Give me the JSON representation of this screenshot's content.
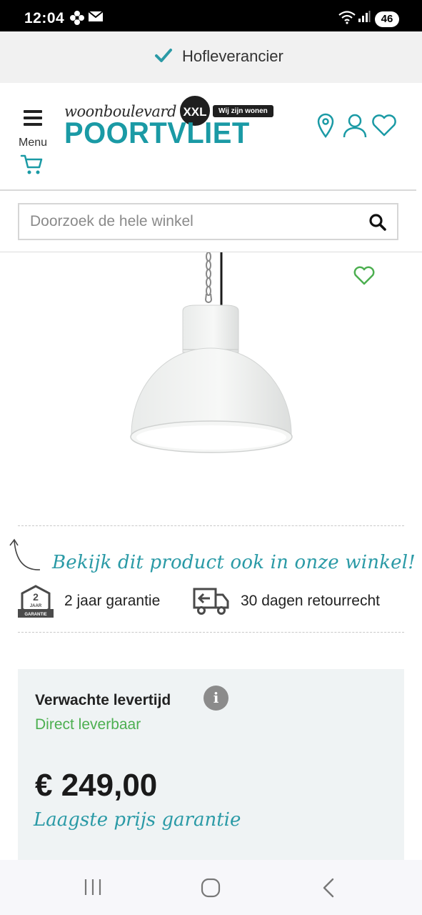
{
  "status_bar": {
    "time": "12:04",
    "battery": "46"
  },
  "top_banner": {
    "text": "Hofleverancier"
  },
  "header": {
    "menu_label": "Menu",
    "logo": {
      "small_text": "woonboulevard",
      "badge": "XXL",
      "tagline": "Wij zijn wonen",
      "big_text": "POORTVLIET"
    }
  },
  "search": {
    "placeholder": "Doorzoek de hele winkel"
  },
  "product": {
    "store_cta": "Bekijk dit product ook in onze winkel!",
    "usps": [
      {
        "icon": "guarantee-badge-icon",
        "badge_number": "2",
        "badge_word": "JAAR",
        "badge_sub": "GARANTIE",
        "text": "2 jaar garantie"
      },
      {
        "icon": "return-truck-icon",
        "text": "30 dagen retourrecht"
      }
    ]
  },
  "delivery": {
    "label": "Verwachte levertijd",
    "info_symbol": "i",
    "status": "Direct leverbaar",
    "price": "€ 249,00",
    "price_guarantee": "Laagste prijs garantie"
  },
  "colors": {
    "brand_teal": "#1a9aa5",
    "available_green": "#4caf50",
    "box_bg": "#eff3f4"
  }
}
